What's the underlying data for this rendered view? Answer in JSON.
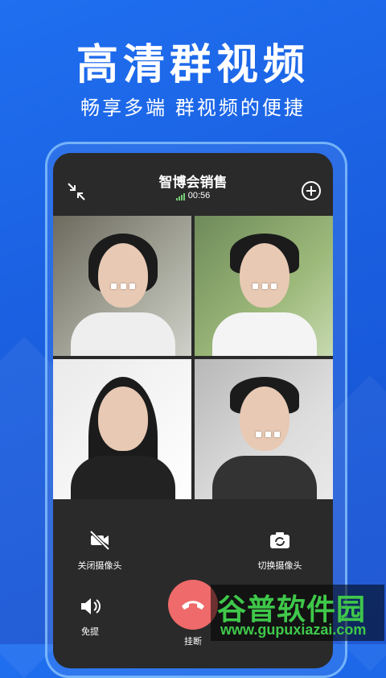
{
  "promo": {
    "headline": "高清群视频",
    "subline": "畅享多端 群视频的便捷"
  },
  "call": {
    "room_title": "智博会销售",
    "duration": "00:56"
  },
  "controls": {
    "camera_off_label": "关闭摄像头",
    "switch_camera_label": "切换摄像头",
    "speaker_label": "免提",
    "hangup_label": "挂断"
  },
  "watermark": {
    "main": "谷普软件园",
    "sub": "www.gupuxiazai.com"
  },
  "colors": {
    "background": "#1f6ff0",
    "panel": "#2a2a2a",
    "hangup": "#ef6a6a",
    "watermark_text": "#3fc84a"
  },
  "icons": {
    "collapse": "collapse-arrows-icon",
    "add": "add-participant-icon",
    "camera_off": "camera-off-icon",
    "switch_camera": "switch-camera-icon",
    "speaker": "speaker-icon",
    "hangup": "phone-hangup-icon",
    "signal": "signal-icon"
  }
}
